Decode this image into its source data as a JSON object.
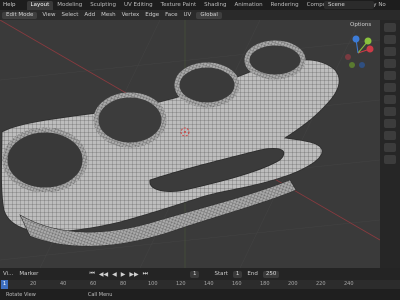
{
  "topbar": {
    "menus": [
      "Help"
    ],
    "tabs": [
      "Layout",
      "Modeling",
      "Sculpting",
      "UV Editing",
      "Texture Paint",
      "Shading",
      "Animation",
      "Rendering",
      "Compositing",
      "Geometry No"
    ],
    "scene": "Scene"
  },
  "toolbar": {
    "mode": "Edit Mode",
    "menus": [
      "View",
      "Select",
      "Add",
      "Mesh",
      "Vertex",
      "Edge",
      "Face",
      "UV"
    ],
    "orientation": "Global"
  },
  "viewport": {
    "options_label": "Options",
    "gizmo": {
      "x": "X",
      "y": "Y",
      "z": "Z"
    },
    "colors": {
      "mesh": "#b9b9b9",
      "wire": "#3c3c3c",
      "background": "#3a3a3a",
      "x_axis": "#cc3b47",
      "y_axis": "#8ac13d",
      "z_axis": "#3d7cd8"
    }
  },
  "timeline": {
    "menus": [
      "Vi...",
      "Marker"
    ],
    "current_frame": "1",
    "start_label": "Start",
    "start_value": "1",
    "end_label": "End",
    "end_value": "250"
  },
  "ruler": {
    "current": "1",
    "ticks": [
      "20",
      "40",
      "60",
      "80",
      "100",
      "120",
      "140",
      "160",
      "180",
      "200",
      "220",
      "240"
    ]
  },
  "status": {
    "items": [
      "Rotate View",
      "Call Menu"
    ]
  }
}
